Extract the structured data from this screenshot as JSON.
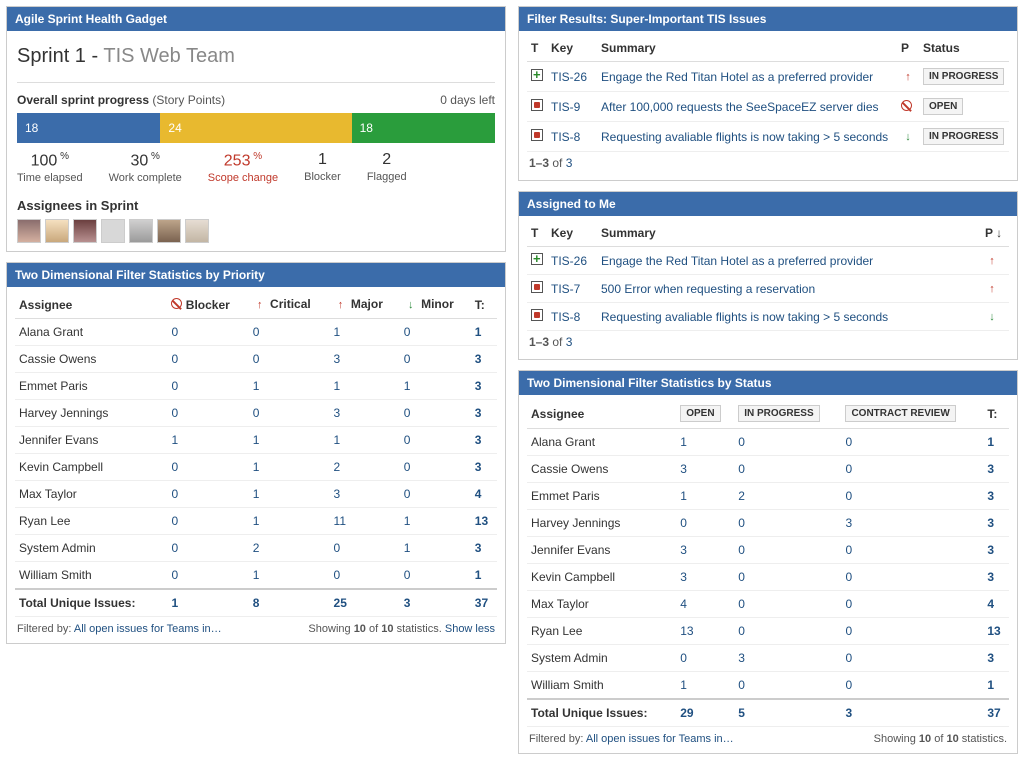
{
  "gadgets": {
    "sprintHealth": {
      "title": "Agile Sprint Health Gadget",
      "sprintName": "Sprint 1",
      "teamName": "TIS Web Team",
      "overall": "Overall sprint progress",
      "overallSuffix": "(Story Points)",
      "daysLeft": "0 days left",
      "segments": [
        {
          "label": "18",
          "color": "#3b6caa",
          "pct": 30
        },
        {
          "label": "24",
          "color": "#e8b92f",
          "pct": 40
        },
        {
          "label": "18",
          "color": "#2a9d3c",
          "pct": 30
        }
      ],
      "metrics": [
        {
          "value": "100",
          "suffix": "%",
          "label": "Time elapsed"
        },
        {
          "value": "30",
          "suffix": "%",
          "label": "Work complete"
        },
        {
          "value": "253",
          "suffix": "%",
          "label": "Scope change",
          "red": true
        },
        {
          "value": "1",
          "suffix": "",
          "label": "Blocker"
        },
        {
          "value": "2",
          "suffix": "",
          "label": "Flagged"
        }
      ],
      "assigneesTitle": "Assignees in Sprint",
      "avatarCount": 7
    },
    "filterResults": {
      "title": "Filter Results: Super-Important TIS Issues",
      "cols": {
        "t": "T",
        "key": "Key",
        "summary": "Summary",
        "p": "P",
        "status": "Status"
      },
      "rows": [
        {
          "t": "green",
          "key": "TIS-26",
          "summary": "Engage the Red Titan Hotel as a preferred provider",
          "p": "up",
          "status": "IN PROGRESS"
        },
        {
          "t": "red",
          "key": "TIS-9",
          "summary": "After 100,000 requests the SeeSpaceEZ server dies",
          "p": "block",
          "status": "OPEN"
        },
        {
          "t": "red",
          "key": "TIS-8",
          "summary": "Requesting avaliable flights is now taking > 5 seconds",
          "p": "down",
          "status": "IN PROGRESS"
        }
      ],
      "page": {
        "range": "1–3",
        "of": "of",
        "total": "3"
      }
    },
    "assignedToMe": {
      "title": "Assigned to Me",
      "cols": {
        "t": "T",
        "key": "Key",
        "summary": "Summary",
        "p": "P ↓"
      },
      "rows": [
        {
          "t": "green",
          "key": "TIS-26",
          "summary": "Engage the Red Titan Hotel as a preferred provider",
          "p": "up"
        },
        {
          "t": "red",
          "key": "TIS-7",
          "summary": "500 Error when requesting a reservation",
          "p": "up"
        },
        {
          "t": "red",
          "key": "TIS-8",
          "summary": "Requesting avaliable flights is now taking > 5 seconds",
          "p": "down"
        }
      ],
      "page": {
        "range": "1–3",
        "of": "of",
        "total": "3"
      }
    },
    "statsPriority": {
      "title": "Two Dimensional Filter Statistics by Priority",
      "firstCol": "Assignee",
      "cols": [
        {
          "icon": "block",
          "label": "Blocker"
        },
        {
          "icon": "up",
          "label": "Critical"
        },
        {
          "icon": "up",
          "label": "Major"
        },
        {
          "icon": "down",
          "label": "Minor"
        }
      ],
      "tcol": "T:",
      "rows": [
        {
          "name": "Alana Grant",
          "vals": [
            "0",
            "0",
            "1",
            "0"
          ],
          "t": "1"
        },
        {
          "name": "Cassie Owens",
          "vals": [
            "0",
            "0",
            "3",
            "0"
          ],
          "t": "3"
        },
        {
          "name": "Emmet Paris",
          "vals": [
            "0",
            "1",
            "1",
            "1"
          ],
          "t": "3"
        },
        {
          "name": "Harvey Jennings",
          "vals": [
            "0",
            "0",
            "3",
            "0"
          ],
          "t": "3"
        },
        {
          "name": "Jennifer Evans",
          "vals": [
            "1",
            "1",
            "1",
            "0"
          ],
          "t": "3"
        },
        {
          "name": "Kevin Campbell",
          "vals": [
            "0",
            "1",
            "2",
            "0"
          ],
          "t": "3"
        },
        {
          "name": "Max Taylor",
          "vals": [
            "0",
            "1",
            "3",
            "0"
          ],
          "t": "4"
        },
        {
          "name": "Ryan Lee",
          "vals": [
            "0",
            "1",
            "11",
            "1"
          ],
          "t": "13"
        },
        {
          "name": "System Admin",
          "vals": [
            "0",
            "2",
            "0",
            "1"
          ],
          "t": "3"
        },
        {
          "name": "William Smith",
          "vals": [
            "0",
            "1",
            "0",
            "0"
          ],
          "t": "1"
        }
      ],
      "total": {
        "label": "Total Unique Issues:",
        "vals": [
          "1",
          "8",
          "25",
          "3"
        ],
        "t": "37"
      },
      "footerLeft": "Filtered by:",
      "footerLink": "All open issues for Teams in…",
      "footerRight1": "Showing",
      "footerRight2": "10",
      "footerRight3": "of",
      "footerRight4": "10",
      "footerRight5": "statistics.",
      "showLess": "Show less"
    },
    "statsStatus": {
      "title": "Two Dimensional Filter Statistics by Status",
      "firstCol": "Assignee",
      "cols": [
        "OPEN",
        "IN PROGRESS",
        "CONTRACT REVIEW"
      ],
      "tcol": "T:",
      "rows": [
        {
          "name": "Alana Grant",
          "vals": [
            "1",
            "0",
            "0"
          ],
          "t": "1"
        },
        {
          "name": "Cassie Owens",
          "vals": [
            "3",
            "0",
            "0"
          ],
          "t": "3"
        },
        {
          "name": "Emmet Paris",
          "vals": [
            "1",
            "2",
            "0"
          ],
          "t": "3"
        },
        {
          "name": "Harvey Jennings",
          "vals": [
            "0",
            "0",
            "3"
          ],
          "t": "3"
        },
        {
          "name": "Jennifer Evans",
          "vals": [
            "3",
            "0",
            "0"
          ],
          "t": "3"
        },
        {
          "name": "Kevin Campbell",
          "vals": [
            "3",
            "0",
            "0"
          ],
          "t": "3"
        },
        {
          "name": "Max Taylor",
          "vals": [
            "4",
            "0",
            "0"
          ],
          "t": "4"
        },
        {
          "name": "Ryan Lee",
          "vals": [
            "13",
            "0",
            "0"
          ],
          "t": "13"
        },
        {
          "name": "System Admin",
          "vals": [
            "0",
            "3",
            "0"
          ],
          "t": "3"
        },
        {
          "name": "William Smith",
          "vals": [
            "1",
            "0",
            "0"
          ],
          "t": "1"
        }
      ],
      "total": {
        "label": "Total Unique Issues:",
        "vals": [
          "29",
          "5",
          "3"
        ],
        "t": "37"
      },
      "footerLeft": "Filtered by:",
      "footerLink": "All open issues for Teams in…",
      "footerRight1": "Showing",
      "footerRight2": "10",
      "footerRight3": "of",
      "footerRight4": "10",
      "footerRight5": "statistics."
    }
  }
}
